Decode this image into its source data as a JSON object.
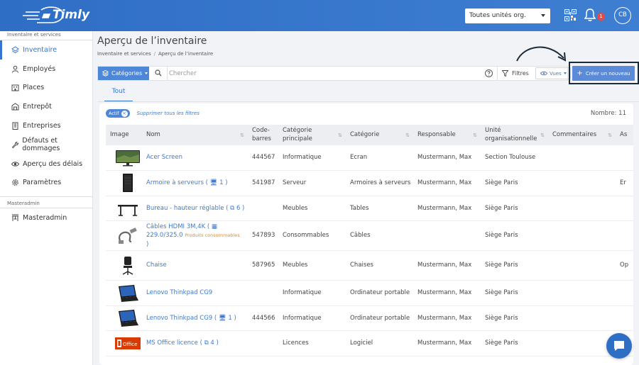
{
  "app": {
    "logo_text": "Timly",
    "unit_select_value": "Toutes unités org.",
    "notification_count": "1",
    "user_initials": "CB"
  },
  "sidebar": {
    "section_top": "Inventaire et services",
    "items": [
      {
        "label": "Inventaire",
        "icon": "inventory-icon",
        "active": true
      },
      {
        "label": "Employés",
        "icon": "person-icon"
      },
      {
        "label": "Places",
        "icon": "building-icon"
      },
      {
        "label": "Entrepôt",
        "icon": "warehouse-icon"
      },
      {
        "label": "Entreprises",
        "icon": "company-icon"
      },
      {
        "label": "Défauts et dommages",
        "icon": "wrench-icon"
      },
      {
        "label": "Aperçu des délais",
        "icon": "eye-icon"
      },
      {
        "label": "Paramètres",
        "icon": "gear-icon"
      }
    ],
    "section_master": "Masteradmin",
    "master_items": [
      {
        "label": "Masteradmin",
        "icon": "masteradmin-icon"
      }
    ]
  },
  "page": {
    "title": "Aperçu de l’inventaire",
    "breadcrumb": [
      "Inventaire et services",
      "Aperçu de l’inventaire"
    ]
  },
  "toolbar": {
    "categories_label": "Catégories",
    "search_placeholder": "Chercher",
    "filters_label": "Filtres",
    "views_label": "Vues",
    "create_label": "Créer un nouveau"
  },
  "tabs": [
    {
      "label": "Tout"
    }
  ],
  "filters": {
    "chip_label": "Actif",
    "clear_label": "Supprimer tous les filtres",
    "count_label": "Nombre: 11"
  },
  "table": {
    "columns": [
      "Image",
      "Nom",
      "Code-barres",
      "Catégorie principale",
      "Catégorie",
      "Responsable",
      "Unité organisationnelle",
      "Commentaires",
      "As"
    ],
    "rows": [
      {
        "image": "monitor-image",
        "name": "Acer Screen",
        "name_suffix": "",
        "sub": "",
        "barcode": "444567",
        "main_category": "Informatique",
        "category": "Ecran",
        "responsible": "Mustermann, Max",
        "unit": "Section Toulouse",
        "comments": "",
        "extra": ""
      },
      {
        "image": "server-cabinet-image",
        "name": "Armoire à serveurs",
        "name_suffix": " ( 🖥 1 )",
        "sub": "",
        "barcode": "541987",
        "main_category": "Serveur",
        "category": "Armoires à serveurs",
        "responsible": "Mustermann, Max",
        "unit": "Siège Paris",
        "comments": "",
        "extra": "Er"
      },
      {
        "image": "desk-image",
        "name": "Bureau - hauteur réglable",
        "name_suffix": " ( ⧉ 6 )",
        "sub": "",
        "barcode": "",
        "main_category": "Meubles",
        "category": "Tables",
        "responsible": "Mustermann, Max",
        "unit": "Siège Paris",
        "comments": "",
        "extra": ""
      },
      {
        "image": "hdmi-cable-image",
        "name": "Câbles HDMI 3M,4K",
        "name_suffix": " ( ▦",
        "sub_value": "229.0/325.0",
        "sub": "Produits consommables",
        "barcode": "547893",
        "main_category": "Consommables",
        "category": "Câbles",
        "responsible": "",
        "unit": "Siège Paris",
        "comments": "",
        "extra": ""
      },
      {
        "image": "office-chair-image",
        "name": "Chaise",
        "name_suffix": "",
        "sub": "",
        "barcode": "587965",
        "main_category": "Meubles",
        "category": "Chaises",
        "responsible": "Mustermann, Max",
        "unit": "Siège Paris",
        "comments": "",
        "extra": "Op"
      },
      {
        "image": "laptop-image",
        "name": "Lenovo Thinkpad CG9",
        "name_suffix": "",
        "sub": "",
        "barcode": "",
        "main_category": "Informatique",
        "category": "Ordinateur portable",
        "responsible": "Mustermann, Max",
        "unit": "Siège Paris",
        "comments": "",
        "extra": ""
      },
      {
        "image": "laptop-image",
        "name": "Lenovo Thinkpad CG9",
        "name_suffix": " ( 🖥 1 )",
        "sub": "",
        "barcode": "444566",
        "main_category": "Informatique",
        "category": "Ordinateur portable",
        "responsible": "Mustermann, Max",
        "unit": "Siège Paris",
        "comments": "",
        "extra": ""
      },
      {
        "image": "ms-office-image",
        "name": "MS Office licence",
        "name_suffix": " ( ⧉ 4 )",
        "sub": "",
        "barcode": "",
        "main_category": "Licences",
        "category": "Logiciel",
        "responsible": "Mustermann, Max",
        "unit": "Siège Paris",
        "comments": "",
        "extra": ""
      }
    ]
  },
  "office_logo_text": "Office",
  "colors": {
    "brand": "#2f6ec5",
    "link": "#3f7ad0",
    "accent_orange": "#e08a2e"
  }
}
